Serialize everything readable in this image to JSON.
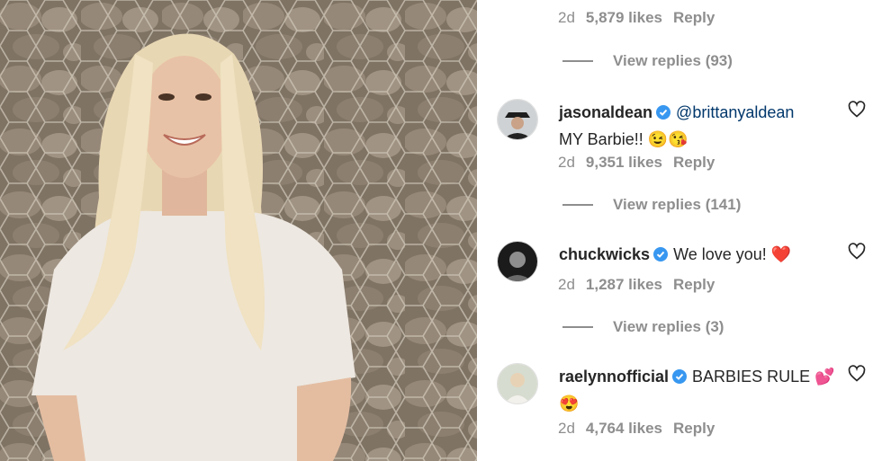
{
  "photo": {
    "alt_icon": "woman-photo"
  },
  "top_comment": {
    "age": "2d",
    "likes": "5,879 likes",
    "reply": "Reply",
    "view_replies": "View replies (93)"
  },
  "comments": [
    {
      "username": "jasonaldean",
      "mention": "@brittanyaldean",
      "text": "MY Barbie!! 😉😘",
      "age": "2d",
      "likes": "9,351 likes",
      "reply": "Reply",
      "view_replies": "View replies (141)"
    },
    {
      "username": "chuckwicks",
      "text": "We love you! ❤️",
      "age": "2d",
      "likes": "1,287 likes",
      "reply": "Reply",
      "view_replies": "View replies (3)"
    },
    {
      "username": "raelynnofficial",
      "text": "BARBIES RULE 💕😍",
      "age": "2d",
      "likes": "4,764 likes",
      "reply": "Reply"
    }
  ],
  "colors": {
    "secondary_text": "#8e8e8e",
    "verified_badge": "#3897f0",
    "mention": "#00376b"
  }
}
